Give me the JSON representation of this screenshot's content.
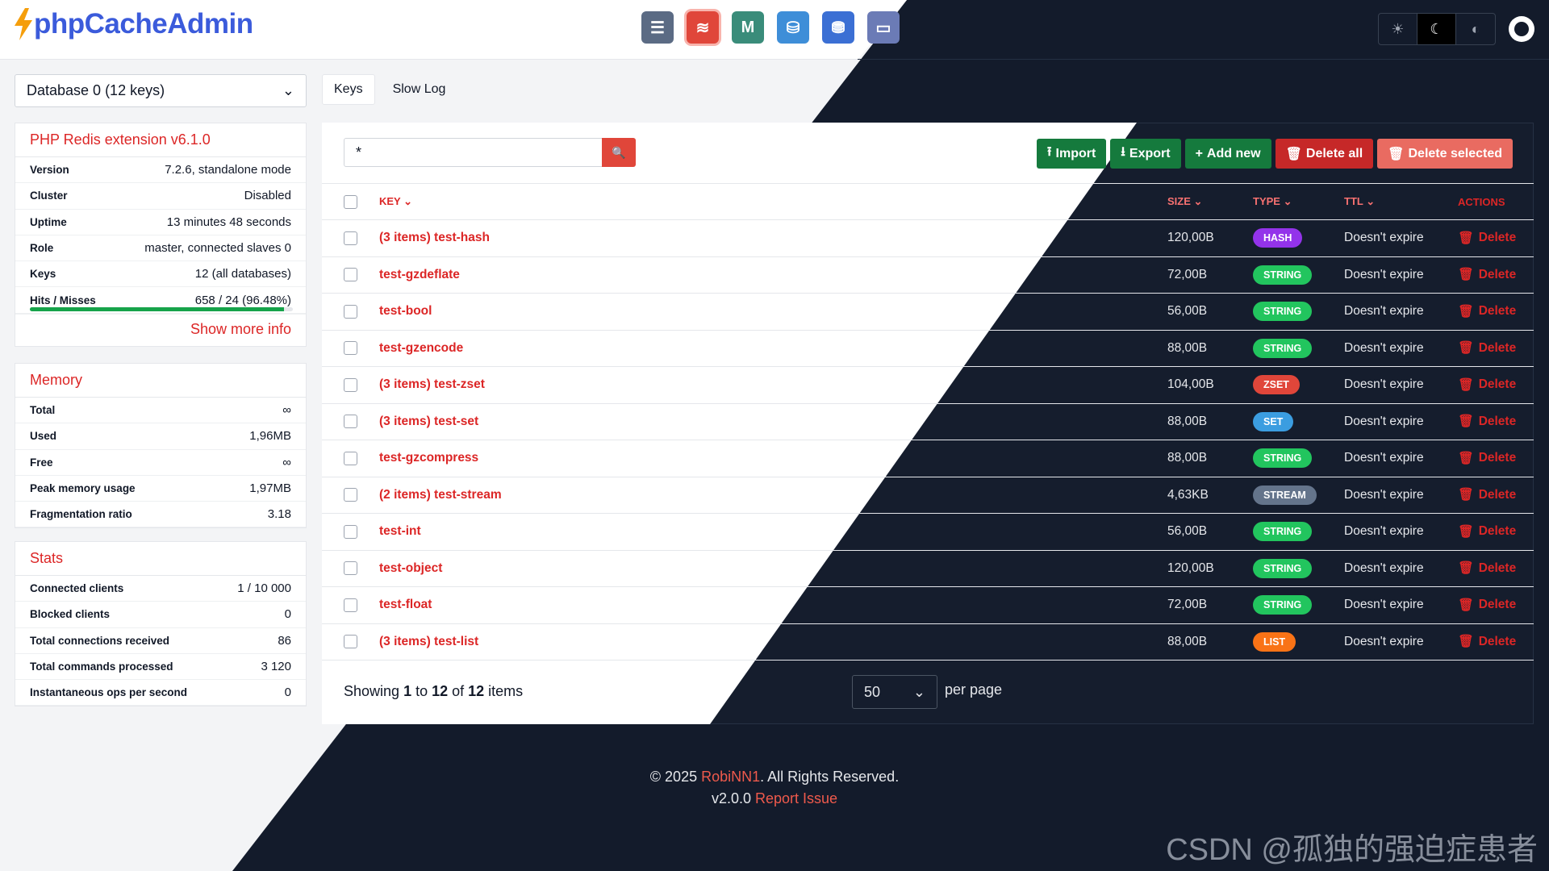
{
  "app": {
    "name": "phpCacheAdmin"
  },
  "nav": {
    "icons": [
      {
        "name": "server-icon",
        "color": "#5b6b84",
        "glyph": "☰"
      },
      {
        "name": "redis-icon",
        "color": "#e0463a",
        "glyph": "≋"
      },
      {
        "name": "memcached-icon",
        "color": "#3a8c7a",
        "glyph": "M"
      },
      {
        "name": "opcache-icon",
        "color": "#3e8ed8",
        "glyph": "⛁"
      },
      {
        "name": "apcu-icon",
        "color": "#3b6fd4",
        "glyph": "⛃"
      },
      {
        "name": "realpath-icon",
        "color": "#6b7bb6",
        "glyph": "▭"
      }
    ]
  },
  "theme": {
    "light": "☀",
    "dark": "☾",
    "auto": "◐"
  },
  "database": {
    "selected": "Database 0 (12 keys)"
  },
  "tabs": [
    "Keys",
    "Slow Log"
  ],
  "server": {
    "title": "PHP Redis extension v6.1.0",
    "rows": [
      {
        "k": "Version",
        "v": "7.2.6, standalone mode"
      },
      {
        "k": "Cluster",
        "v": "Disabled"
      },
      {
        "k": "Uptime",
        "v": "13 minutes 48 seconds"
      },
      {
        "k": "Role",
        "v": "master, connected slaves 0"
      },
      {
        "k": "Keys",
        "v": "12 (all databases)"
      },
      {
        "k": "Hits / Misses",
        "v": "658 / 24 (96.48%)"
      }
    ],
    "hit_ratio": 0.9648,
    "show_more": "Show more info"
  },
  "memory": {
    "title": "Memory",
    "rows": [
      {
        "k": "Total",
        "v": "∞"
      },
      {
        "k": "Used",
        "v": "1,96MB"
      },
      {
        "k": "Free",
        "v": "∞"
      },
      {
        "k": "Peak memory usage",
        "v": "1,97MB"
      },
      {
        "k": "Fragmentation ratio",
        "v": "3.18"
      }
    ]
  },
  "stats": {
    "title": "Stats",
    "rows": [
      {
        "k": "Connected clients",
        "v": "1 / 10 000"
      },
      {
        "k": "Blocked clients",
        "v": "0"
      },
      {
        "k": "Total connections received",
        "v": "86"
      },
      {
        "k": "Total commands processed",
        "v": "3 120"
      },
      {
        "k": "Instantaneous ops per second",
        "v": "0"
      }
    ]
  },
  "search": {
    "value": "*"
  },
  "actions": [
    {
      "label": "Import",
      "icon": "⭱",
      "color": "#157a3d",
      "name": "import-button"
    },
    {
      "label": "Export",
      "icon": "⭳",
      "color": "#157a3d",
      "name": "export-button"
    },
    {
      "label": "Add new",
      "icon": "+",
      "color": "#157a3d",
      "name": "add-new-button"
    },
    {
      "label": "Delete all",
      "icon": "🗑",
      "color": "#c62828",
      "name": "delete-all-button"
    },
    {
      "label": "Delete selected",
      "icon": "🗑",
      "color": "#e96b61",
      "name": "delete-selected-button"
    }
  ],
  "columns": {
    "key": "KEY",
    "size": "SIZE",
    "type": "TYPE",
    "ttl": "TTL",
    "actions": "ACTIONS"
  },
  "rows": [
    {
      "key": "(3 items) test-hash",
      "size": "120,00B",
      "type": "HASH",
      "color": "#9333ea",
      "ttl": "Doesn't expire"
    },
    {
      "key": "test-gzdeflate",
      "size": "72,00B",
      "type": "STRING",
      "color": "#22c55e",
      "ttl": "Doesn't expire"
    },
    {
      "key": "test-bool",
      "size": "56,00B",
      "type": "STRING",
      "color": "#22c55e",
      "ttl": "Doesn't expire"
    },
    {
      "key": "test-gzencode",
      "size": "88,00B",
      "type": "STRING",
      "color": "#22c55e",
      "ttl": "Doesn't expire"
    },
    {
      "key": "(3 items) test-zset",
      "size": "104,00B",
      "type": "ZSET",
      "color": "#e0463a",
      "ttl": "Doesn't expire"
    },
    {
      "key": "(3 items) test-set",
      "size": "88,00B",
      "type": "SET",
      "color": "#3b9de0",
      "ttl": "Doesn't expire"
    },
    {
      "key": "test-gzcompress",
      "size": "88,00B",
      "type": "STRING",
      "color": "#22c55e",
      "ttl": "Doesn't expire"
    },
    {
      "key": "(2 items) test-stream",
      "size": "4,63KB",
      "type": "STREAM",
      "color": "#64748b",
      "ttl": "Doesn't expire"
    },
    {
      "key": "test-int",
      "size": "56,00B",
      "type": "STRING",
      "color": "#22c55e",
      "ttl": "Doesn't expire"
    },
    {
      "key": "test-object",
      "size": "120,00B",
      "type": "STRING",
      "color": "#22c55e",
      "ttl": "Doesn't expire"
    },
    {
      "key": "test-float",
      "size": "72,00B",
      "type": "STRING",
      "color": "#22c55e",
      "ttl": "Doesn't expire"
    },
    {
      "key": "(3 items) test-list",
      "size": "88,00B",
      "type": "LIST",
      "color": "#f97316",
      "ttl": "Doesn't expire"
    }
  ],
  "row_action": "Delete",
  "pagination": {
    "showing_pre": "Showing ",
    "from": "1",
    "to_word": " to ",
    "to": "12",
    "of_word": " of ",
    "total": "12",
    "items_word": " items",
    "per_page_value": "50",
    "per_page_label": "per page"
  },
  "footer": {
    "copyright_pre": "© 2025 ",
    "author": "RobiNN1",
    "copyright_post": ". All Rights Reserved.",
    "version": "v2.0.0",
    "report": "Report Issue"
  },
  "watermark": "CSDN @孤独的强迫症患者"
}
